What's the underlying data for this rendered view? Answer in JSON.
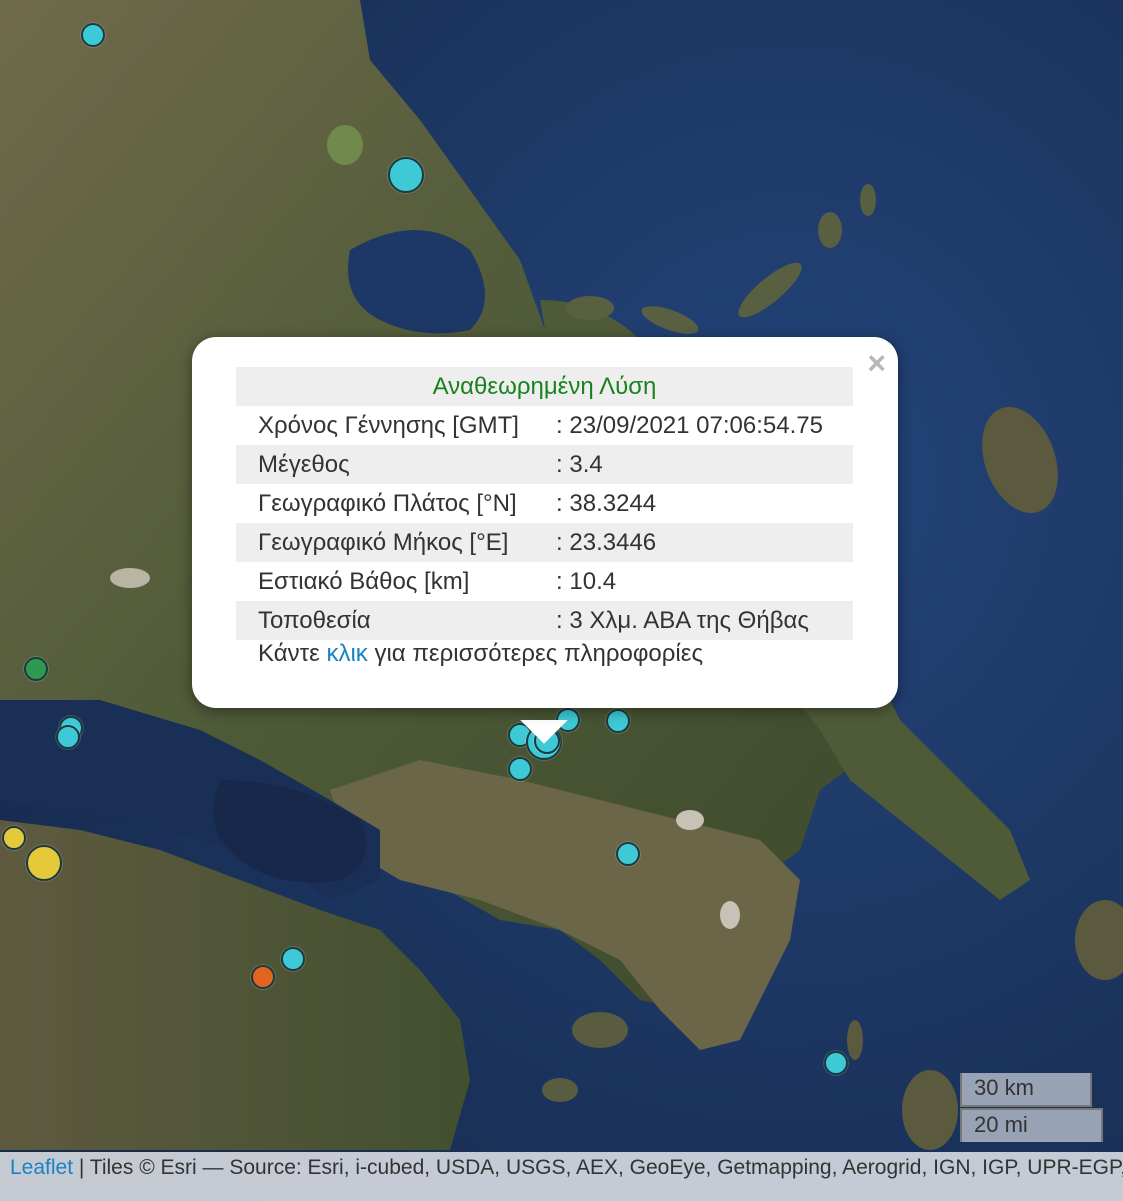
{
  "popup": {
    "title": "Αναθεωρημένη Λύση",
    "rows": [
      {
        "label": "Χρόνος Γέννησης [GMT]",
        "value": ": 23/09/2021 07:06:54.75"
      },
      {
        "label": "Μέγεθος",
        "value": ": 3.4"
      },
      {
        "label": "Γεωγραφικό Πλάτος [°N]",
        "value": ": 38.3244"
      },
      {
        "label": "Γεωγραφικό Μήκος [°E]",
        "value": ": 23.3446"
      },
      {
        "label": "Εστιακό Βάθος [km]",
        "value": ": 10.4"
      },
      {
        "label": "Τοποθεσία",
        "value": ": 3 Χλμ. ΑΒΑ της Θήβας"
      }
    ],
    "more_prefix": "Κάντε ",
    "more_link": "κλικ",
    "more_suffix": " για περισσότερες πληροφορίες",
    "close_label": "×"
  },
  "scale": {
    "km": "30 km",
    "mi": "20 mi"
  },
  "attribution": {
    "link": "Leaflet",
    "text": " | Tiles © Esri — Source: Esri, i-cubed, USDA, USGS, AEX, GeoEye, Getmapping, Aerogrid, IGN, IGP, UPR-EGP, and the GIS User Community"
  },
  "colors": {
    "marker_cyan": "#3ec9d6",
    "marker_green": "#2e9a4f",
    "marker_yellow": "#e6c93a",
    "marker_orange": "#e2651f",
    "title_green": "#19821f",
    "link_blue": "#1a83c4"
  }
}
